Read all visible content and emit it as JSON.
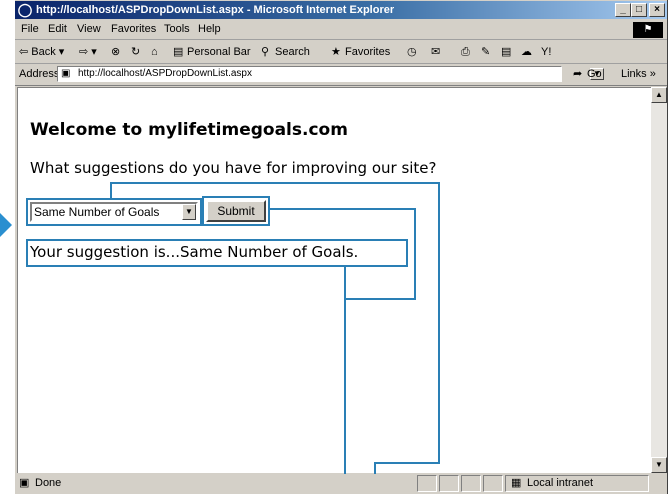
{
  "window": {
    "title": "http://localhost/ASPDropDownList.aspx - Microsoft Internet Explorer",
    "min_label": "_",
    "max_label": "□",
    "close_label": "×"
  },
  "menu": [
    "File",
    "Edit",
    "View",
    "Favorites",
    "Tools",
    "Help"
  ],
  "toolbar": {
    "back": "⇦ Back ▾",
    "forward": "⇨ ▾",
    "personal_bar": "Personal Bar",
    "search": "Search",
    "favorites": "Favorites"
  },
  "address": {
    "label": "Address",
    "value": "http://localhost/ASPDropDownList.aspx",
    "go": "Go",
    "links": "Links »"
  },
  "page": {
    "heading": "Welcome to mylifetimegoals.com",
    "question": "What suggestions do you have for improving our site?",
    "select_value": "Same Number of Goals",
    "submit_label": "Submit",
    "result": "Your suggestion is...Same Number of Goals."
  },
  "status": {
    "text": "Done",
    "zone": "Local intranet"
  },
  "colors": {
    "titlebar": "#0a246a",
    "callout": "#2a7fb5"
  }
}
